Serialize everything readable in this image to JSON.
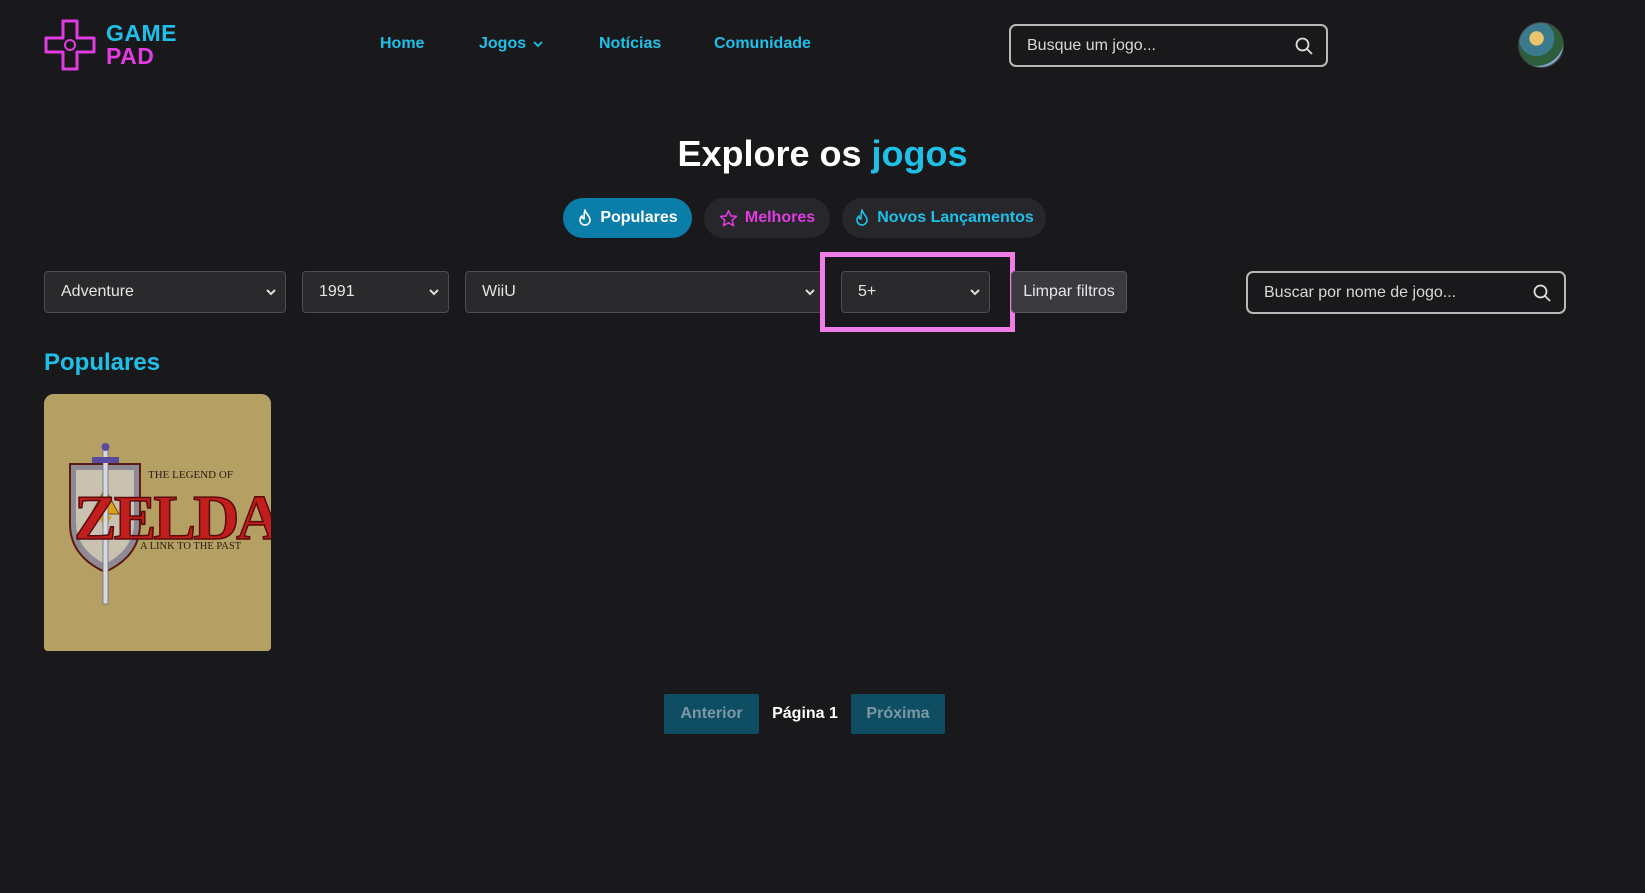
{
  "brand": {
    "line1": "GAME",
    "line2": "PAD",
    "logo_icon": "gamepad-dpad-icon"
  },
  "nav": {
    "items": [
      {
        "label": "Home"
      },
      {
        "label": "Jogos",
        "icon": "chevron-down-icon"
      },
      {
        "label": "Notícias"
      },
      {
        "label": "Comunidade"
      }
    ]
  },
  "header_search": {
    "placeholder": "Busque um jogo...",
    "icon": "search-icon"
  },
  "hero": {
    "title_prefix": "Explore os",
    "title_accent": "jogos"
  },
  "tabs": [
    {
      "label": "Populares",
      "icon": "flame-icon",
      "active": true
    },
    {
      "label": "Melhores",
      "icon": "star-icon",
      "active": false
    },
    {
      "label": "Novos Lançamentos",
      "icon": "flame-icon",
      "active": false
    }
  ],
  "filters": {
    "genre": "Adventure",
    "year": "1991",
    "platform": "WiiU",
    "age_rating": "5+",
    "clear_label": "Limpar filtros",
    "name_search_placeholder": "Buscar por nome de jogo..."
  },
  "section": {
    "title": "Populares"
  },
  "games": [
    {
      "title_line1": "THE LEGEND OF",
      "title_main": "ZELDA",
      "subtitle": "A LINK TO THE PAST"
    }
  ],
  "pagination": {
    "prev_label": "Anterior",
    "page_label": "Página 1",
    "next_label": "Próxima"
  },
  "colors": {
    "background": "#19191c",
    "accent_cyan": "#1ec0e8",
    "accent_magenta": "#e03ce0",
    "highlight_box": "#f07ce8",
    "active_tab": "#0a7ea8",
    "card_bg": "#b5a063"
  }
}
